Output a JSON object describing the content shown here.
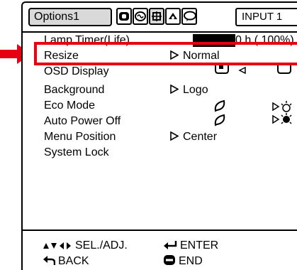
{
  "header": {
    "active_tab": "Options1",
    "tab_icons": [
      "picture-icon",
      "audio-icon",
      "options1-icon",
      "options2-icon",
      "language-icon"
    ],
    "input": "INPUT 1"
  },
  "lamp": {
    "label": "Lamp Timer(Life)",
    "value": "0 h ( 100%)"
  },
  "menu": [
    {
      "label": "Resize",
      "value": "Normal",
      "has_arrow": true
    },
    {
      "label": "OSD Display",
      "value": "",
      "has_arrow": false
    },
    {
      "label": "Background",
      "value": "Logo",
      "has_arrow": true
    },
    {
      "label": "Eco Mode",
      "value": "",
      "has_arrow": false
    },
    {
      "label": "Auto Power Off",
      "value": "",
      "has_arrow": false
    },
    {
      "label": "Menu Position",
      "value": "Center",
      "has_arrow": true
    },
    {
      "label": "System Lock",
      "value": "",
      "has_arrow": false
    }
  ],
  "footer": {
    "select_adjust": "SEL./ADJ.",
    "enter": "ENTER",
    "back": "BACK",
    "end": "END"
  },
  "colors": {
    "highlight": "#e60012",
    "tab_bg": "#d9d9d9"
  }
}
